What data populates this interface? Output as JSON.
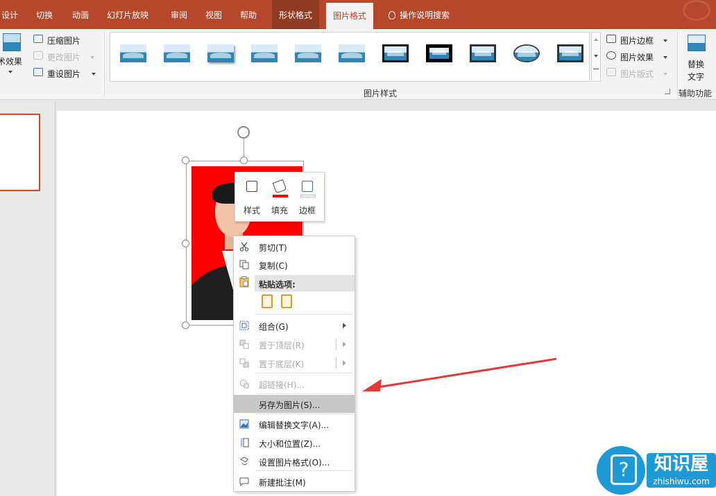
{
  "tabs": [
    {
      "label": "设计"
    },
    {
      "label": "切换"
    },
    {
      "label": "动画"
    },
    {
      "label": "幻灯片放映"
    },
    {
      "label": "审阅"
    },
    {
      "label": "视图"
    },
    {
      "label": "帮助"
    },
    {
      "label": "形状格式"
    },
    {
      "label": "图片格式"
    },
    {
      "label": "操作说明搜索"
    }
  ],
  "ribbon": {
    "artistic_effects": "术效果",
    "compress": "压缩图片",
    "change_picture": "更改图片",
    "reset_picture": "重设图片",
    "picture_border": "图片边框",
    "picture_effects": "图片效果",
    "picture_layout": "图片版式",
    "group_picture_styles": "图片样式",
    "alt_text_line1": "替换",
    "alt_text_line2": "文字",
    "group_accessibility": "辅助功能",
    "gallery_count": 11
  },
  "mini_toolbar": {
    "style": "样式",
    "fill": "填充",
    "border": "边框",
    "fill_color": "#ff0000"
  },
  "context_menu": {
    "cut": "剪切(T)",
    "copy": "复制(C)",
    "paste_options": "粘贴选项:",
    "group": "组合(G)",
    "bring_to_front": "置于顶层(R)",
    "send_to_back": "置于底层(K)",
    "hyperlink": "超链接(H)...",
    "save_as_picture": "另存为图片(S)...",
    "edit_alt_text": "编辑替换文字(A)...",
    "size_position": "大小和位置(Z)...",
    "format_picture": "设置图片格式(O)...",
    "new_comment": "新建批注(M)"
  },
  "colors": {
    "ribbon_tab_bar": "#b7472a",
    "photo_background": "#ff0000",
    "arrow": "#e53935",
    "watermark": "#1e9bd7"
  },
  "watermark": {
    "title": "知识屋",
    "subtitle": "zhishiwu.com"
  }
}
